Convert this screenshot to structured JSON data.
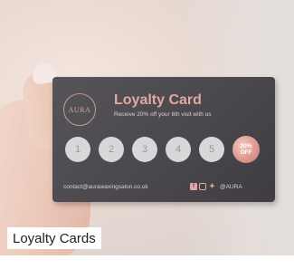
{
  "card": {
    "logo_text": "AURA",
    "title": "Loyalty Card",
    "subtitle": "Receive 20% off your 6th visit with us",
    "stamps": [
      "1",
      "2",
      "3",
      "4",
      "5"
    ],
    "reward_line1": "20%",
    "reward_line2": "OFF",
    "email": "contact@aurawaxingsalon.co.uk",
    "social_handle": "@AURA"
  },
  "caption": "Loyalty Cards",
  "colors": {
    "card_bg": "#4a484c",
    "accent": "#e1a9a2"
  }
}
